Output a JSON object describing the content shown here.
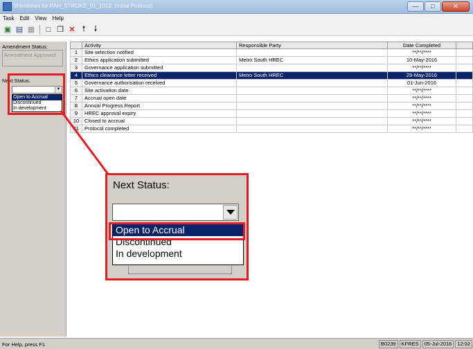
{
  "window": {
    "title": "Milestones for PAH_STROKE_01_1012. (Initial Protocol)"
  },
  "menu": [
    "Task",
    "Edit",
    "View",
    "Help"
  ],
  "toolbar": {
    "icons": [
      "save-exit-icon",
      "save-icon",
      "grid-icon",
      "new-document-icon",
      "copy-document-icon",
      "delete-icon",
      "move-up-icon",
      "move-down-icon"
    ]
  },
  "left_panel": {
    "amendment_status_label": "Amendment Status:",
    "amendment_status_value": "Amendment Approved",
    "next_status_label": "Next Status:",
    "next_status_options": [
      "Open to Accrual",
      "Discontinued",
      "In development"
    ],
    "selected_option_index": 0
  },
  "grid": {
    "columns": [
      "",
      "Activity",
      "Responsible Party",
      "Date Completed"
    ],
    "rows": [
      {
        "num": "1",
        "activity": "Site selection notified",
        "party": "",
        "date": "**/**/****"
      },
      {
        "num": "2",
        "activity": "Ethics application submitted",
        "party": "Metro South HREC",
        "date": "10-May-2016"
      },
      {
        "num": "3",
        "activity": "Governance application submitted",
        "party": "",
        "date": "**/**/****"
      },
      {
        "num": "4",
        "activity": "Ethics clearance letter received",
        "party": "Metro South HREC",
        "date": "29-May-2016"
      },
      {
        "num": "5",
        "activity": "Governance authorisation received",
        "party": "",
        "date": "01-Jun-2016"
      },
      {
        "num": "6",
        "activity": "Site activation date",
        "party": "",
        "date": "**/**/****"
      },
      {
        "num": "7",
        "activity": "Accrual open date",
        "party": "",
        "date": "**/**/****"
      },
      {
        "num": "8",
        "activity": "Annual Progress Report",
        "party": "",
        "date": "**/**/****"
      },
      {
        "num": "9",
        "activity": "HREC approval expiry",
        "party": "",
        "date": "**/**/****"
      },
      {
        "num": "10",
        "activity": "Closed to accrual",
        "party": "",
        "date": "**/**/****"
      },
      {
        "num": "11",
        "activity": "Protocol completed",
        "party": "",
        "date": "**/**/****"
      }
    ],
    "selected_row_index": 3
  },
  "zoom": {
    "label": "Next Status:",
    "options": [
      "Open to Accrual",
      "Discontinued",
      "In development"
    ]
  },
  "status_bar": {
    "help": "For Help, press F1",
    "cells": [
      "B0239",
      "KFRES",
      "05-Jul-2016",
      "12:02"
    ]
  },
  "colors": {
    "selection": "#0a246a",
    "highlight": "#e51c23",
    "panel": "#d4d0c8"
  }
}
